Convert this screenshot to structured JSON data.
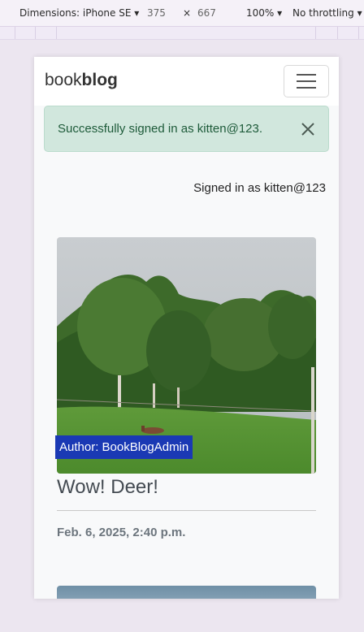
{
  "devtools": {
    "device": "Dimensions: iPhone SE",
    "width": "375",
    "times": "×",
    "height": "667",
    "zoom": "100%",
    "throttle": "No throttling"
  },
  "navbar": {
    "brand_light": "book",
    "brand_bold": "blog"
  },
  "alert": {
    "message": "Successfully signed in as kitten@123."
  },
  "user": {
    "signed_in": "Signed in as kitten@123"
  },
  "post": {
    "author": "Author: BookBlogAdmin",
    "title": "Wow! Deer!",
    "date": "Feb. 6, 2025, 2:40 p.m."
  }
}
